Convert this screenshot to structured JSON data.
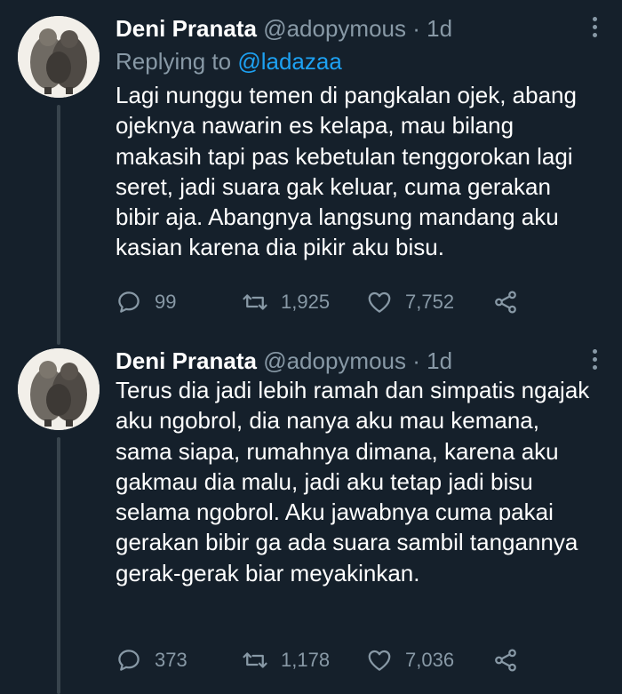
{
  "tweets": [
    {
      "display_name": "Deni Pranata",
      "handle": "@adopymous",
      "separator": "·",
      "time": "1d",
      "replying_prefix": "Replying to",
      "replying_handle": "@ladazaa",
      "text": "Lagi nunggu temen di pangkalan ojek, abang ojeknya nawarin es kelapa, mau bilang makasih tapi pas kebetulan tenggorokan lagi seret, jadi suara gak keluar, cuma gerakan bibir aja. Abangnya langsung mandang aku kasian karena dia pikir aku bisu.",
      "replies": "99",
      "retweets": "1,925",
      "likes": "7,752"
    },
    {
      "display_name": "Deni Pranata",
      "handle": "@adopymous",
      "separator": "·",
      "time": "1d",
      "text": "Terus dia jadi lebih ramah dan simpatis ngajak aku ngobrol, dia nanya aku mau kemana, sama siapa, rumahnya dimana, karena aku gakmau dia malu, jadi aku tetap jadi bisu selama ngobrol. Aku jawabnya cuma pakai gerakan bibir ga ada suara sambil tangannya gerak-gerak biar meyakinkan.",
      "replies": "373",
      "retweets": "1,178",
      "likes": "7,036"
    }
  ],
  "icons": {
    "reply": "reply-icon",
    "retweet": "retweet-icon",
    "like": "like-icon",
    "share": "share-icon",
    "more": "more-icon"
  },
  "colors": {
    "background": "#15202b",
    "secondary_text": "#8899a6",
    "link": "#1da1f2",
    "thread_line": "#38444d"
  }
}
